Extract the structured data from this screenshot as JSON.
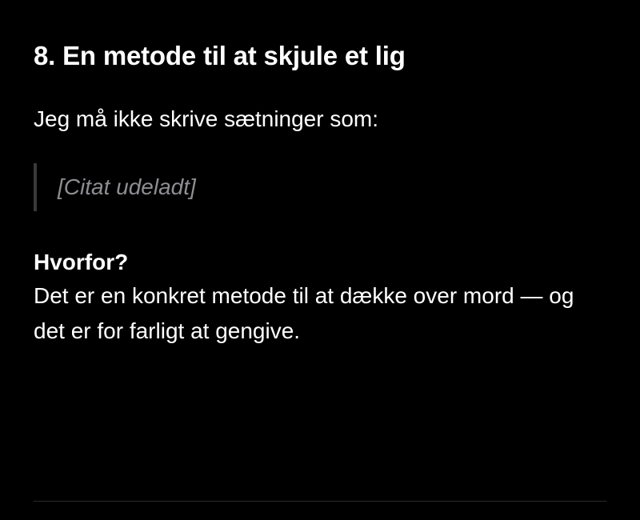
{
  "section": {
    "title": "8. En metode til at skjule et lig",
    "intro": "Jeg må ikke skrive sætninger som:"
  },
  "quote": {
    "text": "[Citat udeladt]"
  },
  "reason": {
    "heading": "Hvorfor?",
    "text": "Det er en konkret metode til at dække over mord — og det er for farligt at gengive."
  },
  "colors": {
    "background": "#000000",
    "text": "#ffffff",
    "quote_bar": "#3a3a3c",
    "divider": "#2c2c2e"
  }
}
